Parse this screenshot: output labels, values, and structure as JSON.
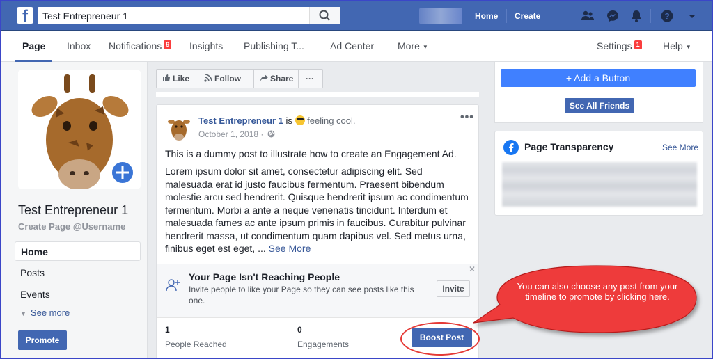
{
  "topbar": {
    "search_value": "Test Entrepreneur 1",
    "home": "Home",
    "create": "Create",
    "icons": [
      "friends-icon",
      "messenger-icon",
      "bell-icon",
      "help-icon",
      "caret-icon"
    ]
  },
  "nav": {
    "page": "Page",
    "inbox": "Inbox",
    "notifications": "Notifications",
    "notifications_count": "9",
    "insights": "Insights",
    "publishing": "Publishing T...",
    "ad_center": "Ad Center",
    "more": "More",
    "settings": "Settings",
    "settings_count": "1",
    "help": "Help"
  },
  "left": {
    "page_name": "Test Entrepreneur 1",
    "username": "Create Page @Username",
    "items": [
      "Home",
      "Posts",
      "Events"
    ],
    "see_more": "See more",
    "promote": "Promote"
  },
  "actions": {
    "like": "Like",
    "follow": "Follow",
    "share": "Share",
    "more": "···"
  },
  "post": {
    "author": "Test Entrepreneur 1",
    "feeling_prefix": "is",
    "feeling": "feeling cool.",
    "date": "October 1, 2018 ·",
    "line1": "This is a dummy post to illustrate how to create an Engagement Ad.",
    "body": "Lorem ipsum dolor sit amet, consectetur adipiscing elit. Sed malesuada erat id justo faucibus fermentum. Praesent bibendum molestie arcu sed hendrerit. Quisque hendrerit ipsum ac condimentum fermentum. Morbi a ante a neque venenatis tincidunt. Interdum et malesuada fames ac ante ipsum primis in faucibus. Curabitur pulvinar hendrerit massa, ut condimentum quam dapibus vel. Sed metus urna, finibus eget est eget, ...",
    "see_more": "See More",
    "reach_title": "Your Page Isn't Reaching People",
    "reach_text": "Invite people to like your Page so they can see posts like this one.",
    "invite": "Invite",
    "reached_count": "1",
    "reached_label": "People Reached",
    "engagements_count": "0",
    "engagements_label": "Engagements",
    "boost": "Boost Post"
  },
  "right": {
    "add_button": "+ Add a Button",
    "see_all_friends": "See All Friends",
    "transparency_title": "Page Transparency",
    "transparency_see_more": "See More"
  },
  "callout": {
    "text": "You can also choose any post from your timeline to promote by clicking here.",
    "color": "#ee3b3b"
  }
}
